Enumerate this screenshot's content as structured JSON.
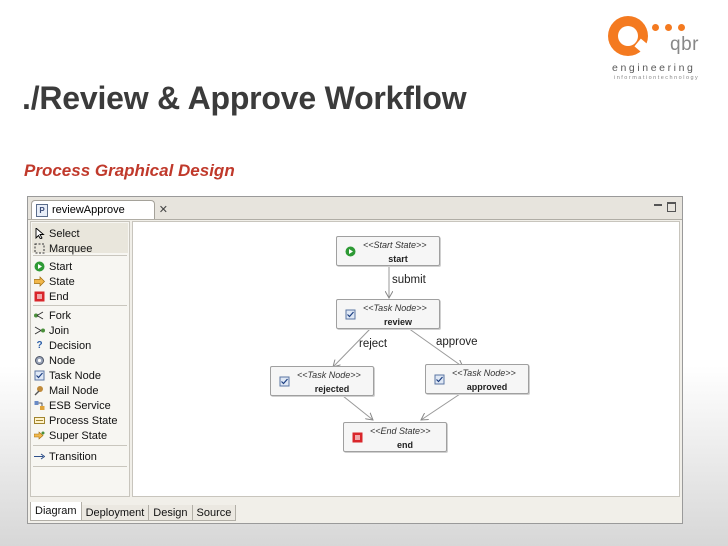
{
  "logo": {
    "brand": "qbr",
    "tagline": "engineering",
    "subtag": "informationtechnology",
    "accent_color": "#f47a20"
  },
  "slide": {
    "title": "./Review & Approve Workflow",
    "subtitle": "Process Graphical Design"
  },
  "editor": {
    "tab_label": "reviewApprove",
    "tab_icon": "process-file-icon",
    "palette": {
      "items": [
        {
          "label": "Select",
          "icon": "pointer-icon"
        },
        {
          "label": "Marquee",
          "icon": "marquee-icon"
        },
        {
          "label": "Start",
          "icon": "start-icon"
        },
        {
          "label": "State",
          "icon": "state-icon"
        },
        {
          "label": "End",
          "icon": "end-icon"
        },
        {
          "label": "Fork",
          "icon": "fork-icon"
        },
        {
          "label": "Join",
          "icon": "join-icon"
        },
        {
          "label": "Decision",
          "icon": "decision-icon"
        },
        {
          "label": "Node",
          "icon": "node-icon"
        },
        {
          "label": "Task Node",
          "icon": "task-node-icon"
        },
        {
          "label": "Mail Node",
          "icon": "mail-node-icon"
        },
        {
          "label": "ESB Service",
          "icon": "esb-service-icon"
        },
        {
          "label": "Process State",
          "icon": "process-state-icon"
        },
        {
          "label": "Super State",
          "icon": "super-state-icon"
        },
        {
          "label": "Transition",
          "icon": "transition-icon"
        }
      ]
    },
    "diagram": {
      "nodes": {
        "start": {
          "stereotype": "<<Start State>>",
          "name": "start"
        },
        "review": {
          "stereotype": "<<Task Node>>",
          "name": "review"
        },
        "rejected": {
          "stereotype": "<<Task Node>>",
          "name": "rejected"
        },
        "approved": {
          "stereotype": "<<Task Node>>",
          "name": "approved"
        },
        "end": {
          "stereotype": "<<End State>>",
          "name": "end"
        }
      },
      "transitions": {
        "submit": "submit",
        "reject": "reject",
        "approve": "approve"
      }
    },
    "bottom_tabs": [
      {
        "label": "Diagram",
        "active": true
      },
      {
        "label": "Deployment",
        "active": false
      },
      {
        "label": "Design",
        "active": false
      },
      {
        "label": "Source",
        "active": false
      }
    ]
  }
}
